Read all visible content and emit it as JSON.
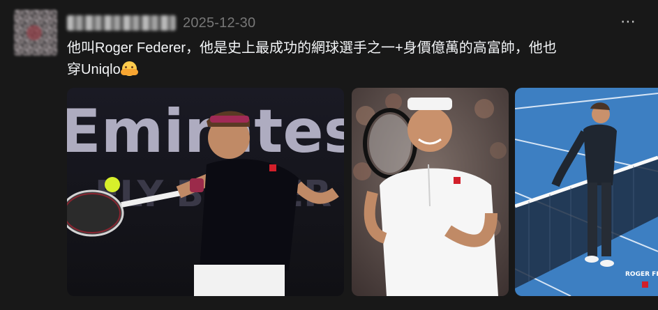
{
  "post": {
    "author_blurred": true,
    "date": "2025-12-30",
    "more_icon": "⋯",
    "text_line1": "他叫Roger Federer，他是史上最成功的網球選手之一+身價億萬的高富帥，他也",
    "text_line2": "穿Uniqlo",
    "emoji": "hugging-face-emoji"
  },
  "media": {
    "image1": {
      "banner_text": "Emirates",
      "banner_text2": "FLY BETTER"
    },
    "image2": {},
    "image3": {
      "caption": "ROGER FEDE"
    }
  },
  "colors": {
    "background": "#181818",
    "text": "#f3f5f7",
    "muted": "#777777",
    "court_blue": "#3d7fc2"
  }
}
